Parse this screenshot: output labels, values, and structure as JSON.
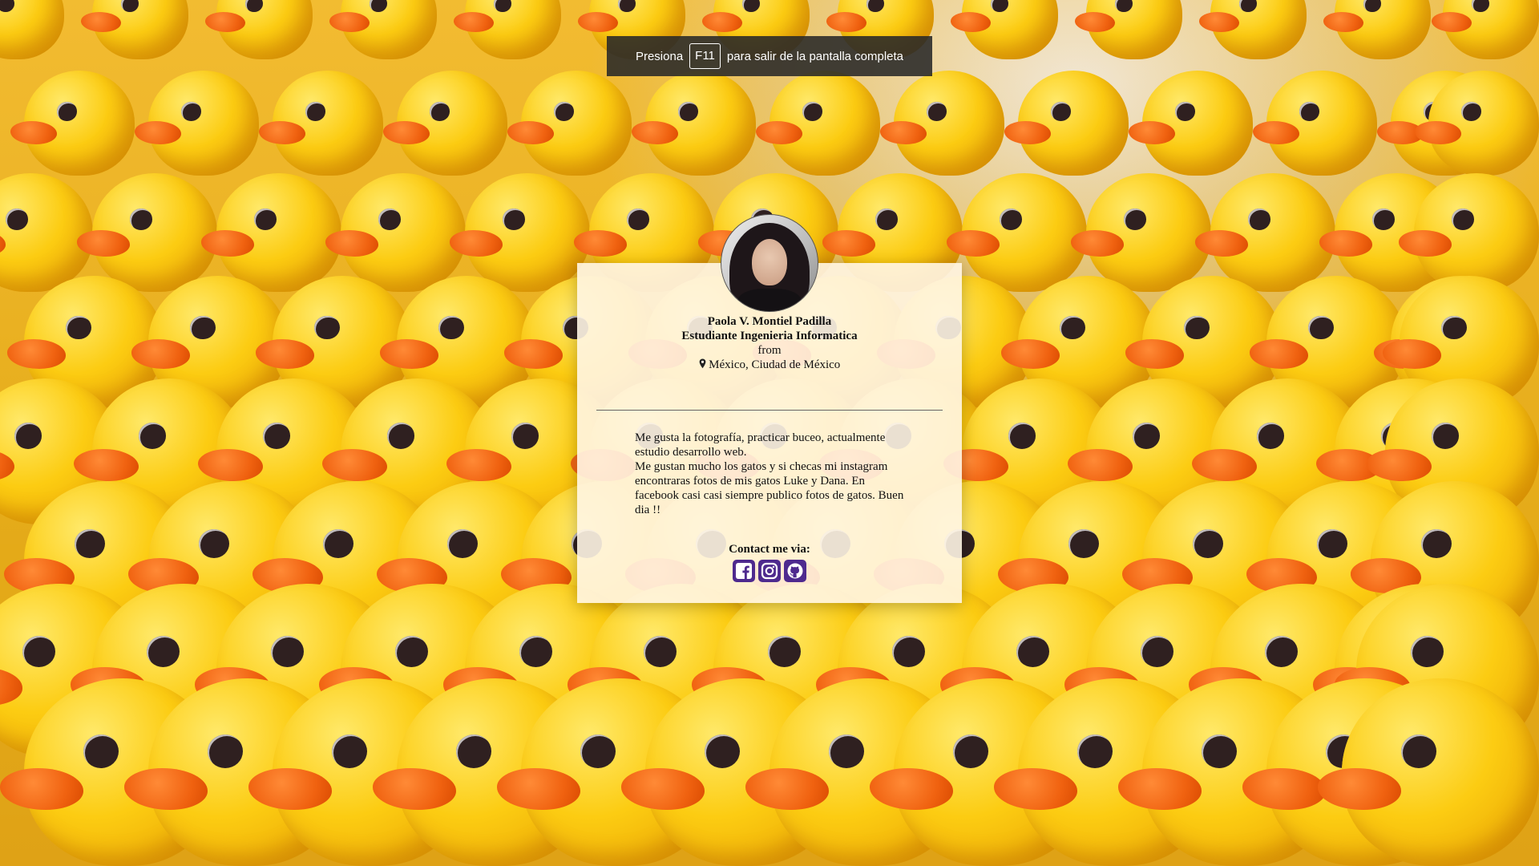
{
  "fullscreen_notice": {
    "prefix": "Presiona",
    "key": "F11",
    "suffix": "para salir de la pantalla completa"
  },
  "profile": {
    "name": "Paola V. Montiel Padilla",
    "title": "Estudiante Ingenieria Informatica",
    "from_label": "from",
    "location": "México, Ciudad de México",
    "bio": [
      "Me gusta la fotografía, practicar buceo, actualmente estudio desarrollo web.",
      "Me gustan mucho los gatos y si checas mi instagram encontraras fotos de mis gatos Luke y Dana. En facebook casi casi siempre publico fotos de gatos. Buen dia !!"
    ],
    "contact_label": "Contact me via:"
  },
  "social": [
    {
      "icon": "facebook-icon"
    },
    {
      "icon": "instagram-icon"
    },
    {
      "icon": "github-icon"
    }
  ],
  "colors": {
    "card_bg": "#fff5e4",
    "social_accent": "#4e2a8e",
    "duck_yellow": "#fccc12",
    "beak_orange": "#f06210",
    "banner_bg": "#282828"
  }
}
